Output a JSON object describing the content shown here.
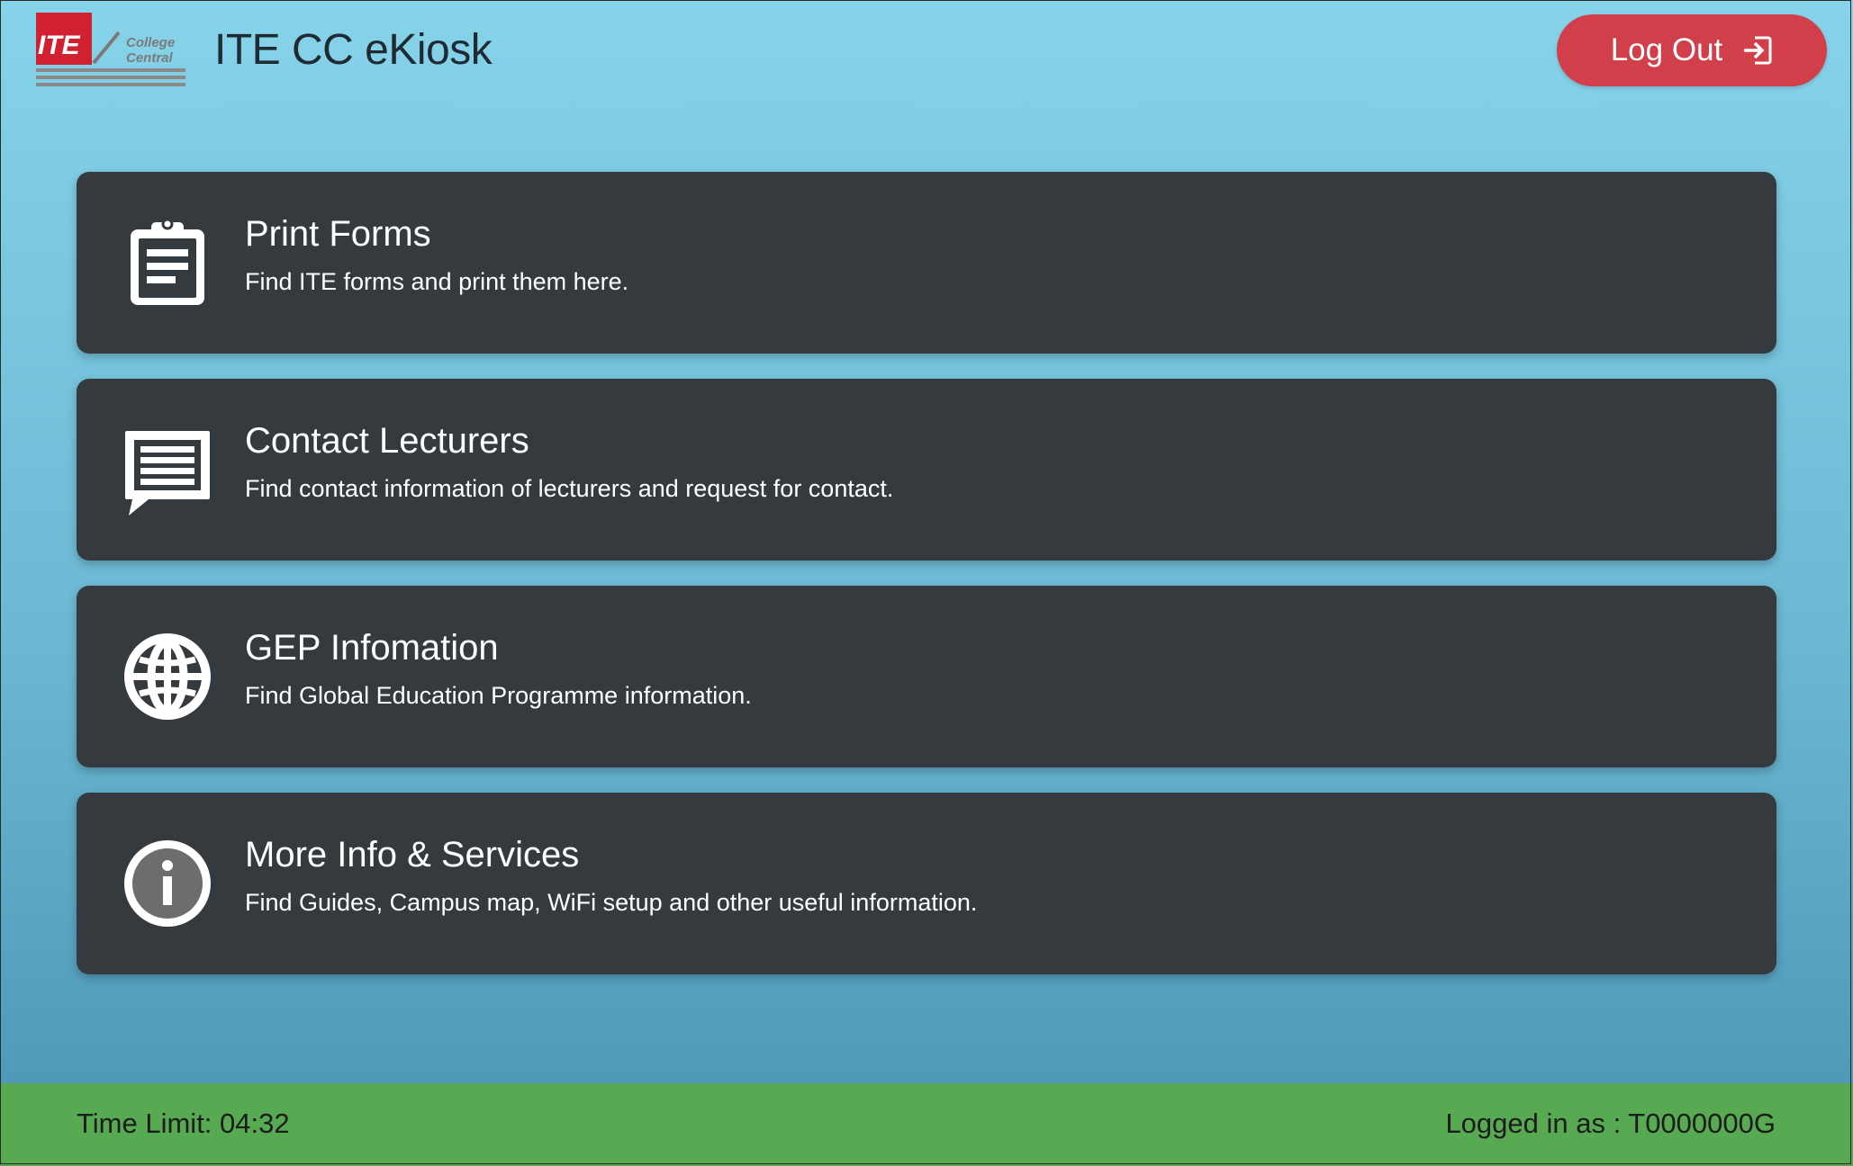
{
  "header": {
    "logo": {
      "mark_text": "ITE",
      "line1": "College",
      "line2": "Central"
    },
    "title": "ITE CC eKiosk",
    "logout_label": "Log Out",
    "logout_icon": "sign-out-icon"
  },
  "cards": [
    {
      "icon": "clipboard-icon",
      "title": "Print Forms",
      "description": "Find ITE forms and print them here."
    },
    {
      "icon": "chat-bubble-icon",
      "title": "Contact Lecturers",
      "description": "Find contact information of lecturers and request for contact."
    },
    {
      "icon": "globe-icon",
      "title": "GEP Infomation",
      "description": "Find Global Education Programme information."
    },
    {
      "icon": "info-icon",
      "title": "More Info & Services",
      "description": "Find Guides, Campus map, WiFi setup and other useful information."
    }
  ],
  "footer": {
    "time_limit": "Time Limit: 04:32",
    "logged_in": "Logged in as : T0000000G"
  },
  "colors": {
    "background_top": "#86d3ea",
    "background_bottom": "#4a94b4",
    "card": "#353a3f",
    "logout": "#d13f4a",
    "footer": "#57a952",
    "logo_red": "#d1202f"
  }
}
